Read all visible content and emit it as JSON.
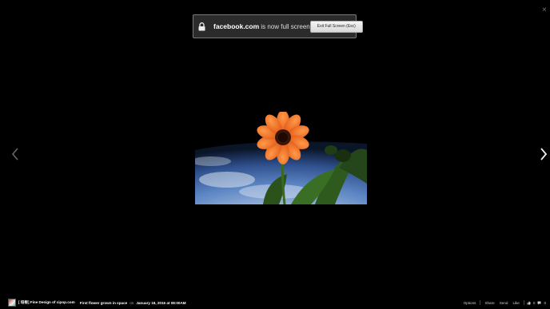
{
  "fullscreen_notice": {
    "domain": "facebook.com",
    "message": "is now full screen",
    "exit_button": "Exit Full Screen (Esc)"
  },
  "viewer": {
    "close_glyph": "×"
  },
  "caption": {
    "page_name": "[ 培根] Fine Design of cipop.com",
    "description": "First flower grown in space",
    "date_prefix": "on",
    "date": "January 18, 2016 at 08:00AM"
  },
  "actions": {
    "options": "Options",
    "share": "Share",
    "send": "Send",
    "like": "Like",
    "like_count": "0",
    "comment_count": "0"
  },
  "colors": {
    "background": "#000000",
    "flower": "#f2661e",
    "earth": "#3b5d9a"
  },
  "icons": [
    "lock-icon",
    "close-icon",
    "chevron-left-icon",
    "chevron-right-icon",
    "like-icon",
    "comment-icon"
  ]
}
